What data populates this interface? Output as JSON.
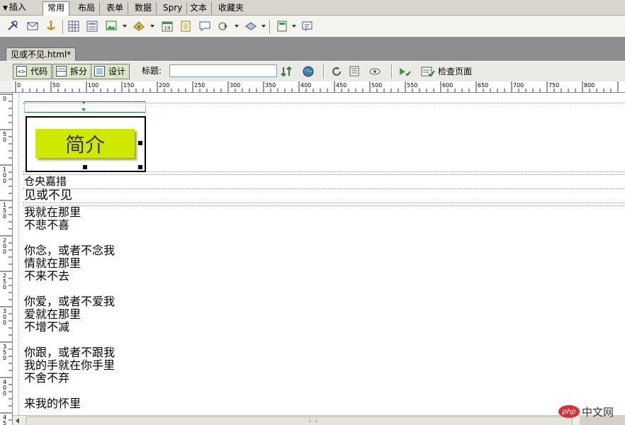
{
  "insert_bar": {
    "title": "插入",
    "tabs": [
      {
        "label": "常用",
        "active": true
      },
      {
        "label": "布局"
      },
      {
        "label": "表单"
      },
      {
        "label": "数据"
      },
      {
        "label": "Spry"
      },
      {
        "label": "文本"
      },
      {
        "label": "收藏夹"
      }
    ],
    "icons": [
      "hyperlink-icon",
      "email-link-icon",
      "named-anchor-icon",
      "table-icon",
      "div-icon",
      "image-icon",
      "media-icon",
      "date-icon",
      "server-include-icon",
      "comment-icon",
      "head-icon",
      "script-icon",
      "templates-icon",
      "tag-chooser-icon"
    ]
  },
  "document": {
    "tab_label": "见或不见.html*"
  },
  "doc_toolbar": {
    "code_label": "代码",
    "split_label": "拆分",
    "design_label": "设计",
    "title_label": "标题:",
    "title_value": "",
    "check_page_label": "检查页面"
  },
  "ruler": {
    "h_labels": [
      "0",
      "50",
      "100",
      "150",
      "200",
      "250",
      "300",
      "350",
      "400",
      "450",
      "500",
      "550",
      "600",
      "650",
      "700",
      "750",
      "800",
      "850"
    ],
    "v_labels": [
      "0",
      "50",
      "100",
      "150",
      "200",
      "250",
      "300",
      "350",
      "400",
      "450"
    ]
  },
  "canvas": {
    "banner_text": "简介",
    "author": "仓央嘉措",
    "title": "见或不见",
    "lines": [
      "我就在那里",
      "不悲不喜",
      "",
      "你念，或者不念我",
      "情就在那里",
      "不来不去",
      "",
      "你爱，或者不爱我",
      "爱就在那里",
      "不增不减",
      "",
      "你跟，或者不跟我",
      "我的手就在你手里",
      "不舍不弃",
      "",
      "来我的怀里"
    ]
  },
  "watermark": {
    "badge": "php",
    "text": "中文网"
  },
  "colors": {
    "banner": "#d0e800",
    "toolbar": "#eceae4",
    "view_button": "#d9e6c8"
  }
}
